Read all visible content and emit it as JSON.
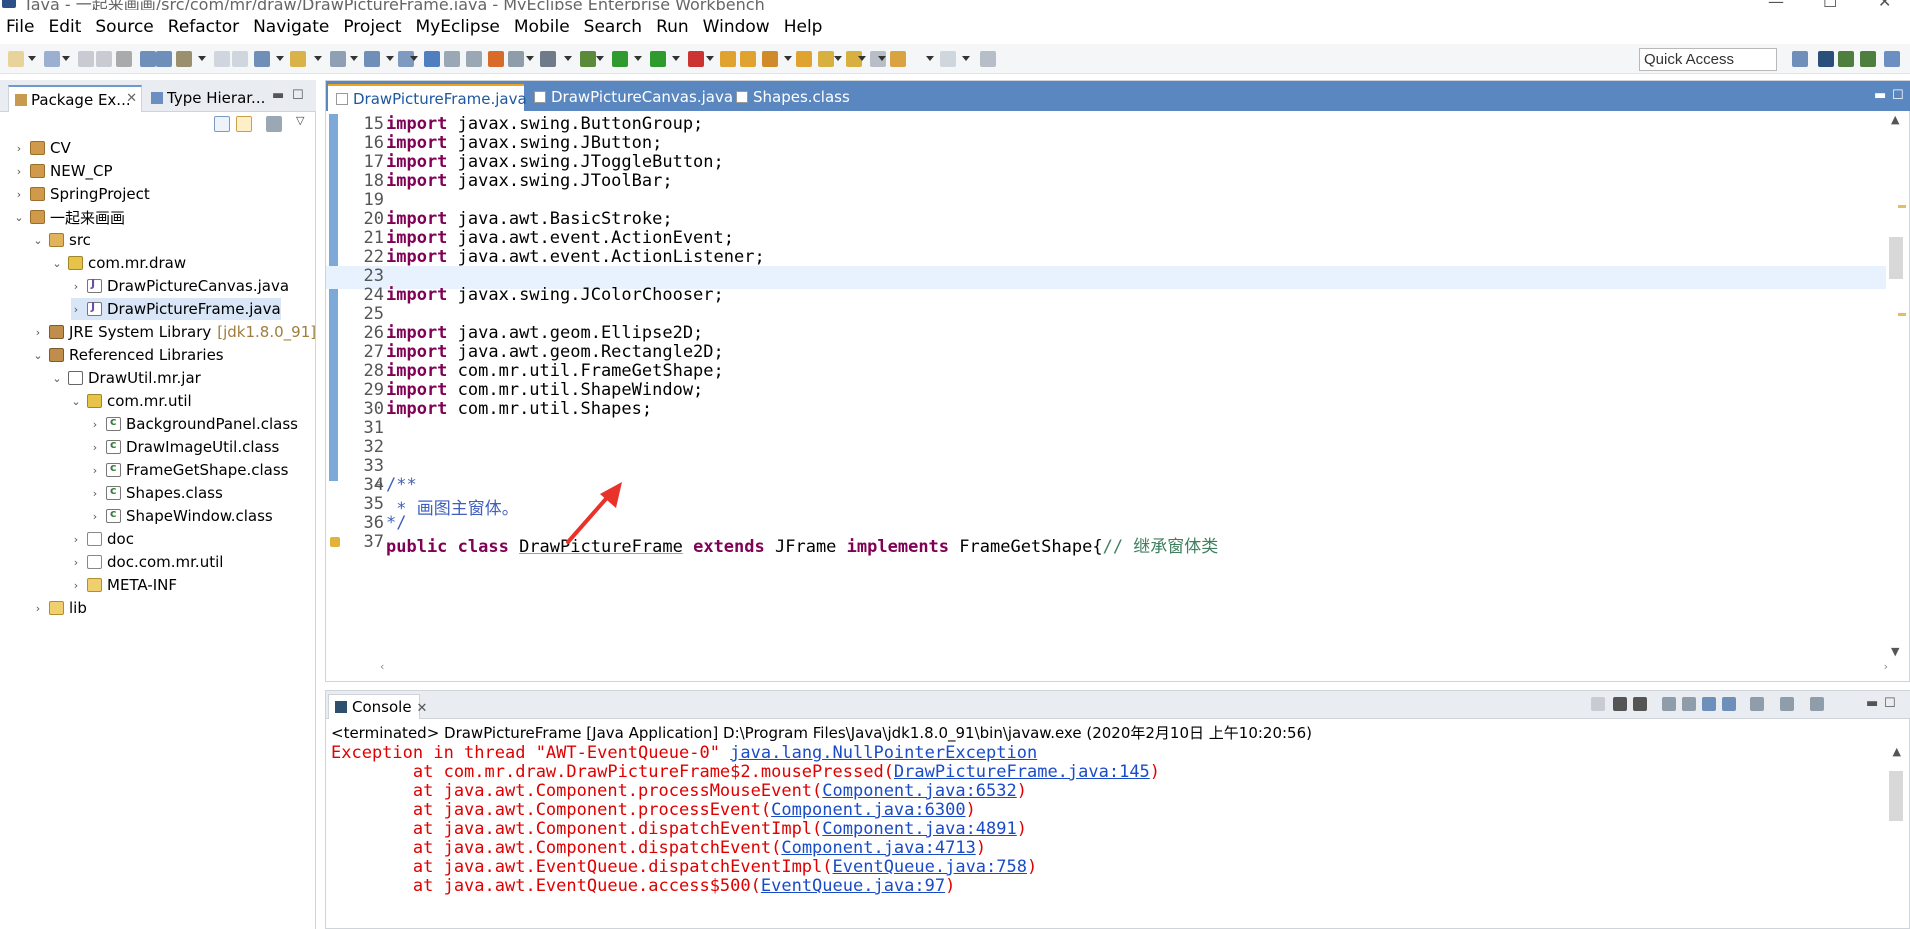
{
  "window": {
    "title": "Java - 一起来画画/src/com/mr/draw/DrawPictureFrame.java - MyEclipse Enterprise Workbench"
  },
  "menu": [
    "File",
    "Edit",
    "Source",
    "Refactor",
    "Navigate",
    "Project",
    "MyEclipse",
    "Mobile",
    "Search",
    "Run",
    "Window",
    "Help"
  ],
  "toolbar": {
    "quick_access": "Quick Access"
  },
  "left_view": {
    "tabs": [
      {
        "label": "Package Ex..."
      },
      {
        "label": "Type Hierar..."
      }
    ],
    "tree": [
      {
        "label": "CV",
        "icon": "project-icon",
        "arrow": "›"
      },
      {
        "label": "NEW_CP",
        "icon": "project-icon",
        "arrow": "›"
      },
      {
        "label": "SpringProject",
        "icon": "project-icon",
        "arrow": "›"
      },
      {
        "label": "一起来画画",
        "icon": "project-icon",
        "arrow": "⌄"
      },
      {
        "label": "src",
        "icon": "source-folder-icon",
        "arrow": "⌄"
      },
      {
        "label": "com.mr.draw",
        "icon": "package-icon",
        "arrow": "⌄"
      },
      {
        "label": "DrawPictureCanvas.java",
        "icon": "java-file-icon",
        "arrow": "›"
      },
      {
        "label": "DrawPictureFrame.java",
        "icon": "java-file-icon",
        "arrow": "›"
      },
      {
        "label": "JRE System Library",
        "icon": "library-icon",
        "arrow": "›",
        "extra": "[jdk1.8.0_91]"
      },
      {
        "label": "Referenced Libraries",
        "icon": "library-icon",
        "arrow": "⌄"
      },
      {
        "label": "DrawUtil.mr.jar",
        "icon": "jar-icon",
        "arrow": "⌄"
      },
      {
        "label": "com.mr.util",
        "icon": "package-icon",
        "arrow": "⌄"
      },
      {
        "label": "BackgroundPanel.class",
        "icon": "class-file-icon",
        "arrow": "›"
      },
      {
        "label": "DrawImageUtil.class",
        "icon": "class-file-icon",
        "arrow": "›"
      },
      {
        "label": "FrameGetShape.class",
        "icon": "class-file-icon",
        "arrow": "›"
      },
      {
        "label": "Shapes.class",
        "icon": "class-file-icon",
        "arrow": "›"
      },
      {
        "label": "ShapeWindow.class",
        "icon": "class-file-icon",
        "arrow": "›"
      },
      {
        "label": "doc",
        "icon": "doc-package-icon",
        "arrow": "›"
      },
      {
        "label": "doc.com.mr.util",
        "icon": "doc-package-icon",
        "arrow": "›"
      },
      {
        "label": "META-INF",
        "icon": "folder-icon",
        "arrow": "›"
      },
      {
        "label": "lib",
        "icon": "folder-icon",
        "arrow": "›"
      }
    ]
  },
  "editor": {
    "tabs": [
      {
        "label": "DrawPictureFrame.java"
      },
      {
        "label": "DrawPictureCanvas.java"
      },
      {
        "label": "Shapes.class"
      }
    ],
    "lines": [
      {
        "no": "15",
        "kw": "import",
        "rest": " javax.swing.ButtonGroup;"
      },
      {
        "no": "16",
        "kw": "import",
        "rest": " javax.swing.JButton;"
      },
      {
        "no": "17",
        "kw": "import",
        "rest": " javax.swing.JToggleButton;"
      },
      {
        "no": "18",
        "kw": "import",
        "rest": " javax.swing.JToolBar;"
      },
      {
        "no": "19",
        "kw": "",
        "rest": ""
      },
      {
        "no": "20",
        "kw": "import",
        "rest": " java.awt.BasicStroke;"
      },
      {
        "no": "21",
        "kw": "import",
        "rest": " java.awt.event.ActionEvent;"
      },
      {
        "no": "22",
        "kw": "import",
        "rest": " java.awt.event.ActionListener;"
      },
      {
        "no": "23",
        "kw": "",
        "rest": ""
      },
      {
        "no": "24",
        "kw": "import",
        "rest": " javax.swing.JColorChooser;"
      },
      {
        "no": "25",
        "kw": "",
        "rest": ""
      },
      {
        "no": "26",
        "kw": "import",
        "rest": " java.awt.geom.Ellipse2D;"
      },
      {
        "no": "27",
        "kw": "import",
        "rest": " java.awt.geom.Rectangle2D;"
      },
      {
        "no": "28",
        "kw": "import",
        "rest": " com.mr.util.FrameGetShape;"
      },
      {
        "no": "29",
        "kw": "import",
        "rest": " com.mr.util.ShapeWindow;"
      },
      {
        "no": "30",
        "kw": "import",
        "rest": " com.mr.util.Shapes;"
      },
      {
        "no": "31",
        "kw": "",
        "rest": ""
      },
      {
        "no": "32",
        "kw": "",
        "rest": ""
      },
      {
        "no": "33",
        "kw": "",
        "rest": ""
      },
      {
        "no": "34",
        "kw": "",
        "rest": "/**",
        "type": "comment"
      },
      {
        "no": "35",
        "kw": "",
        "rest": " * 画图主窗体。",
        "type": "comment"
      },
      {
        "no": "36",
        "kw": "",
        "rest": "*/",
        "type": "comment"
      },
      {
        "no": "37",
        "kw": "",
        "rest": "",
        "type": "classdecl"
      }
    ],
    "class_decl": {
      "kw1": "public class",
      "name": "DrawPictureFrame",
      "kw2": "extends",
      "parent": "JFrame",
      "kw3": "implements",
      "iface": "FrameGetShape{",
      "comment": "// 继承窗体类"
    }
  },
  "console": {
    "tab_label": "Console",
    "status": "<terminated> DrawPictureFrame [Java Application] D:\\Program Files\\Java\\jdk1.8.0_91\\bin\\javaw.exe (2020年2月10日 上午10:20:56)",
    "lines": [
      {
        "prefix": "Exception in thread \"AWT-EventQueue-0\" ",
        "link": "java.lang.NullPointerException",
        "suffix": ""
      },
      {
        "prefix": "\tat com.mr.draw.DrawPictureFrame$2.mousePressed(",
        "link": "DrawPictureFrame.java:145",
        "suffix": ")"
      },
      {
        "prefix": "\tat java.awt.Component.processMouseEvent(",
        "link": "Component.java:6532",
        "suffix": ")"
      },
      {
        "prefix": "\tat java.awt.Component.processEvent(",
        "link": "Component.java:6300",
        "suffix": ")"
      },
      {
        "prefix": "\tat java.awt.Component.dispatchEventImpl(",
        "link": "Component.java:4891",
        "suffix": ")"
      },
      {
        "prefix": "\tat java.awt.Component.dispatchEvent(",
        "link": "Component.java:4713",
        "suffix": ")"
      },
      {
        "prefix": "\tat java.awt.EventQueue.dispatchEventImpl(",
        "link": "EventQueue.java:758",
        "suffix": ")"
      },
      {
        "prefix": "\tat java.awt.EventQueue.access$500(",
        "link": "EventQueue.java:97",
        "suffix": ")"
      }
    ]
  }
}
